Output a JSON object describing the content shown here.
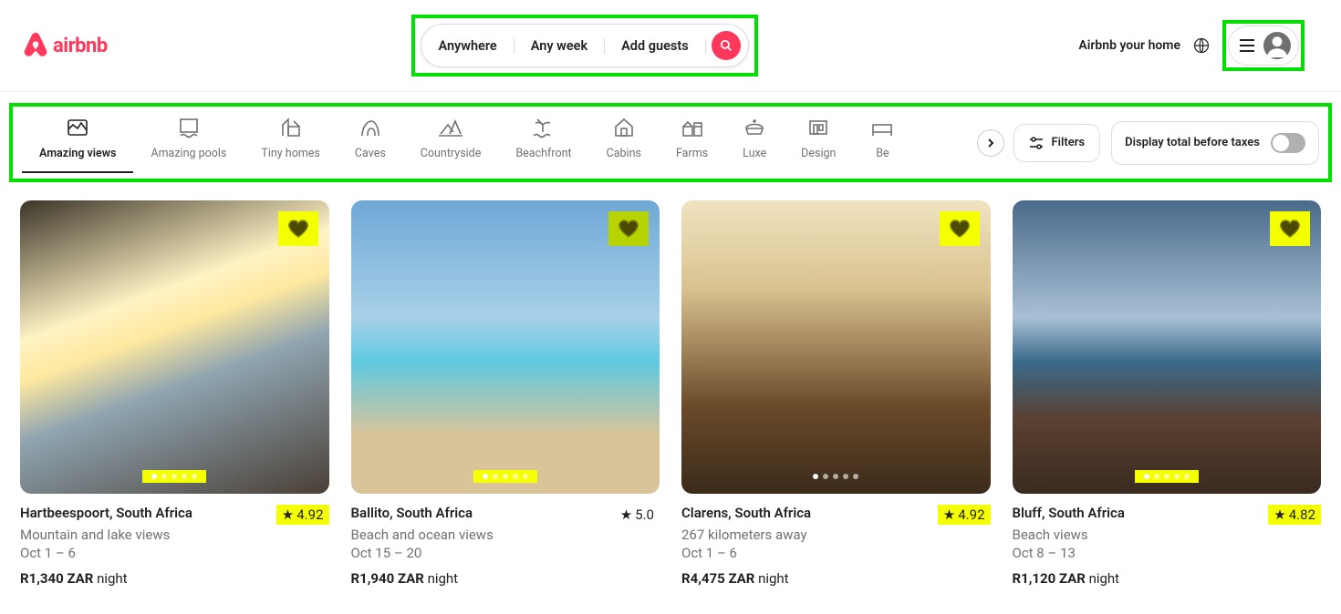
{
  "header": {
    "brand": "airbnb",
    "search": {
      "location": "Anywhere",
      "date": "Any week",
      "guests_placeholder": "Add guests"
    },
    "host_link": "Airbnb your home"
  },
  "categories": {
    "items": [
      {
        "label": "Amazing views",
        "icon": "views",
        "active": true
      },
      {
        "label": "Amazing pools",
        "icon": "pools"
      },
      {
        "label": "Tiny homes",
        "icon": "tiny"
      },
      {
        "label": "Caves",
        "icon": "caves"
      },
      {
        "label": "Countryside",
        "icon": "countryside"
      },
      {
        "label": "Beachfront",
        "icon": "beachfront"
      },
      {
        "label": "Cabins",
        "icon": "cabins"
      },
      {
        "label": "Farms",
        "icon": "farms"
      },
      {
        "label": "Luxe",
        "icon": "luxe"
      },
      {
        "label": "Design",
        "icon": "design"
      },
      {
        "label": "Be",
        "icon": "bed"
      }
    ],
    "filters_label": "Filters",
    "tax_toggle_label": "Display total before taxes"
  },
  "listings": [
    {
      "title": "Hartbeespoort, South Africa",
      "subtitle": "Mountain and lake views",
      "dates": "Oct 1 – 6",
      "price": "R1,340 ZAR",
      "price_unit": "night",
      "rating": "4.92",
      "rating_hl": true,
      "heart_class": "hl",
      "img_class": "img-a",
      "dots_hl": true
    },
    {
      "title": "Ballito, South Africa",
      "subtitle": "Beach and ocean views",
      "dates": "Oct 15 – 20",
      "price": "R1,940 ZAR",
      "price_unit": "night",
      "rating": "5.0",
      "rating_hl": false,
      "heart_class": "hl2",
      "img_class": "img-b",
      "dots_hl": true
    },
    {
      "title": "Clarens, South Africa",
      "subtitle": "267 kilometers away",
      "dates": "Oct 1 – 6",
      "price": "R4,475 ZAR",
      "price_unit": "night",
      "rating": "4.92",
      "rating_hl": true,
      "heart_class": "hl",
      "img_class": "img-c",
      "dots_hl": false
    },
    {
      "title": "Bluff, South Africa",
      "subtitle": "Beach views",
      "dates": "Oct 8 – 13",
      "price": "R1,120 ZAR",
      "price_unit": "night",
      "rating": "4.82",
      "rating_hl": true,
      "heart_class": "hl",
      "img_class": "img-d",
      "dots_hl": true
    }
  ]
}
